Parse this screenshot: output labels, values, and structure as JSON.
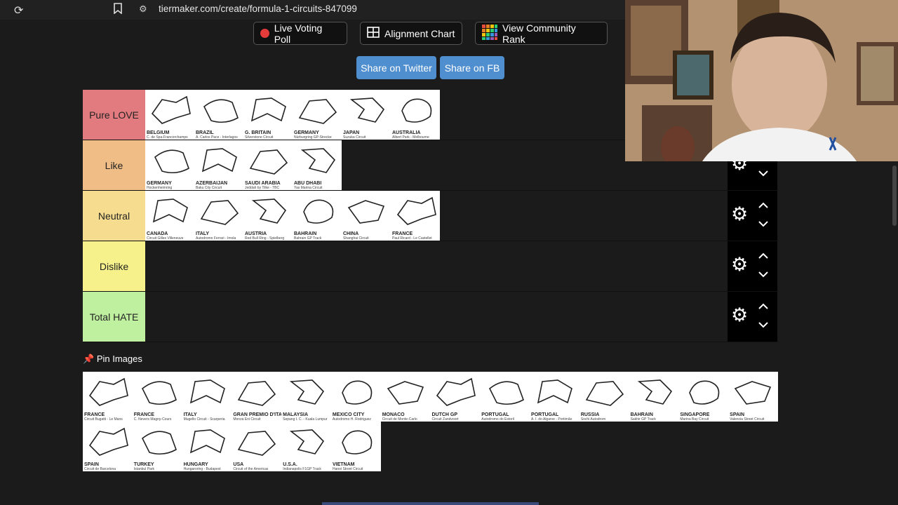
{
  "browser": {
    "url": "tiermaker.com/create/formula-1-circuits-847099"
  },
  "toolbar": {
    "live_voting": "Live Voting Poll",
    "alignment": "Alignment Chart",
    "community": "View Community Rank",
    "share_twitter": "Share on Twitter",
    "share_fb": "Share on FB"
  },
  "tiers": [
    {
      "label": "Pure LOVE",
      "color": "#e27b7f",
      "items": [
        {
          "name": "BELGIUM",
          "sub": "C. de Spa-Francorchamps"
        },
        {
          "name": "BRAZIL",
          "sub": "A. Carlos Pace - Interlagos"
        },
        {
          "name": "G. BRITAIN",
          "sub": "Silverstone Circuit"
        },
        {
          "name": "GERMANY",
          "sub": "Nürburgring GP-Strecke"
        },
        {
          "name": "JAPAN",
          "sub": "Suzuka Circuit"
        },
        {
          "name": "AUSTRALIA",
          "sub": "Albert Park - Melbourne"
        }
      ]
    },
    {
      "label": "Like",
      "color": "#f0bd86",
      "items": [
        {
          "name": "GERMANY",
          "sub": "Hockenheimring"
        },
        {
          "name": "AZERBAIJAN",
          "sub": "Baku City Circuit"
        },
        {
          "name": "SAUDI ARABIA",
          "sub": "Jeddah by Tilke - TBC"
        },
        {
          "name": "ABU DHABI",
          "sub": "Yas Marina Circuit"
        }
      ]
    },
    {
      "label": "Neutral",
      "color": "#f5dc8e",
      "items": [
        {
          "name": "CANADA",
          "sub": "Circuit Gilles Villeneuve"
        },
        {
          "name": "ITALY",
          "sub": "Autodromo Ferrari - Imola"
        },
        {
          "name": "AUSTRIA",
          "sub": "Red Bull Ring - Spielberg"
        },
        {
          "name": "BAHRAIN",
          "sub": "Bahrain GP Track"
        },
        {
          "name": "CHINA",
          "sub": "Shanghai Circuit"
        },
        {
          "name": "FRANCE",
          "sub": "Paul Ricard - Le Castellet"
        }
      ]
    },
    {
      "label": "Dislike",
      "color": "#f6f18a",
      "items": []
    },
    {
      "label": "Total HATE",
      "color": "#bff0a0",
      "items": []
    }
  ],
  "pool": {
    "title": "Pin Images",
    "items": [
      {
        "name": "FRANCE",
        "sub": "Circuit Bugatti - Le Mans"
      },
      {
        "name": "FRANCE",
        "sub": "C. Nevers Magny-Cours"
      },
      {
        "name": "ITALY",
        "sub": "Mugello Circuit - Scarperia"
      },
      {
        "name": "GRAN PREMIO D'ITALIA",
        "sub": "Monza Eni Circuit"
      },
      {
        "name": "MALAYSIA",
        "sub": "Sepang I. C. - Kuala Lumpur"
      },
      {
        "name": "MEXICO CITY",
        "sub": "Autodromo H. Rodriguez"
      },
      {
        "name": "MONACO",
        "sub": "Circuit de Monte-Carlo"
      },
      {
        "name": "DUTCH GP",
        "sub": "Circuit Zandvoort"
      },
      {
        "name": "PORTUGAL",
        "sub": "Autodromo do Estoril"
      },
      {
        "name": "PORTUGAL",
        "sub": "A. I. do Algarve - Portimão"
      },
      {
        "name": "RUSSIA",
        "sub": "Sochi Autodrom"
      },
      {
        "name": "BAHRAIN",
        "sub": "Sakhir GP Track"
      },
      {
        "name": "SINGAPORE",
        "sub": "Marina Bay Circuit"
      },
      {
        "name": "SPAIN",
        "sub": "Valencia Street Circuit"
      },
      {
        "name": "SPAIN",
        "sub": "Circuit de Barcelona"
      },
      {
        "name": "TURKEY",
        "sub": "Istanbul Park"
      },
      {
        "name": "HUNGARY",
        "sub": "Hungaroring - Budapest"
      },
      {
        "name": "USA",
        "sub": "Circuit of the Americas"
      },
      {
        "name": "U.S.A.",
        "sub": "Indianapolis F1GP Track"
      },
      {
        "name": "VIETNAM",
        "sub": "Hanoi Street Circuit"
      }
    ]
  }
}
